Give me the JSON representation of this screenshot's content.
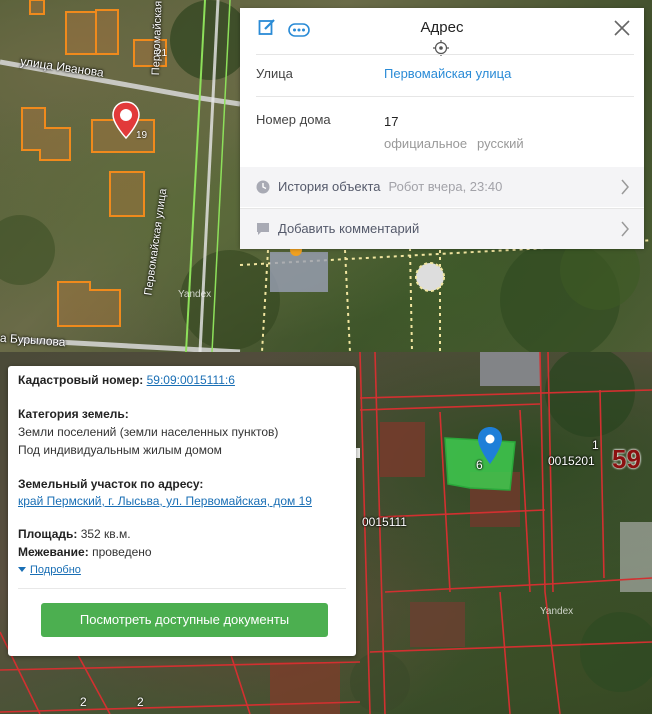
{
  "map_top": {
    "street_ivanova": "улица Иванова",
    "street_pervomayskaya_v": "Первомайская улица",
    "street_pervomayskaya_diag": "Первомайская улица",
    "street_burylova": "а Бурылова",
    "house_21": "21",
    "house_19": "19",
    "watermark": "Yandex"
  },
  "address_panel": {
    "title": "Адрес",
    "street_label": "Улица",
    "street_value": "Первомайская улица",
    "house_label": "Номер дома",
    "house_value": "17",
    "house_sub_1": "официальное",
    "house_sub_2": "русский",
    "history_label": "История объекта",
    "history_meta": "Робот вчера, 23:40",
    "comment_label": "Добавить комментарий"
  },
  "map_bottom": {
    "parcel_num": "6",
    "block_1": "0015201",
    "block_1_top": "1",
    "block_2": "0015111",
    "region": "59",
    "house_2a": "2",
    "house_2b": "2",
    "watermark": "Yandex"
  },
  "cadastral_panel": {
    "cad_number_label": "Кадастровый номер:",
    "cad_number_value": "59:09:0015111:6",
    "category_label": "Категория земель:",
    "category_value": "Земли поселений (земли населенных пунктов)",
    "usage_value": "Под индивидуальным жилым домом",
    "address_label": "Земельный участок по адресу:",
    "address_value": "край Пермский, г. Лысьва, ул. Первомайская, дом 19",
    "area_label": "Площадь:",
    "area_value": "352 кв.м.",
    "survey_label": "Межевание:",
    "survey_value": "проведено",
    "details_link": "Подробно",
    "docs_button": "Посмотреть доступные документы"
  },
  "colors": {
    "accent_link": "#2a8bd6",
    "button_green": "#4caf50",
    "parcel_fill": "#3ecb4f",
    "marker_red": "#e23a3a",
    "marker_blue": "#1e7fd8",
    "cadastral_line": "#d23030",
    "building_outline": "#f08a1c"
  }
}
